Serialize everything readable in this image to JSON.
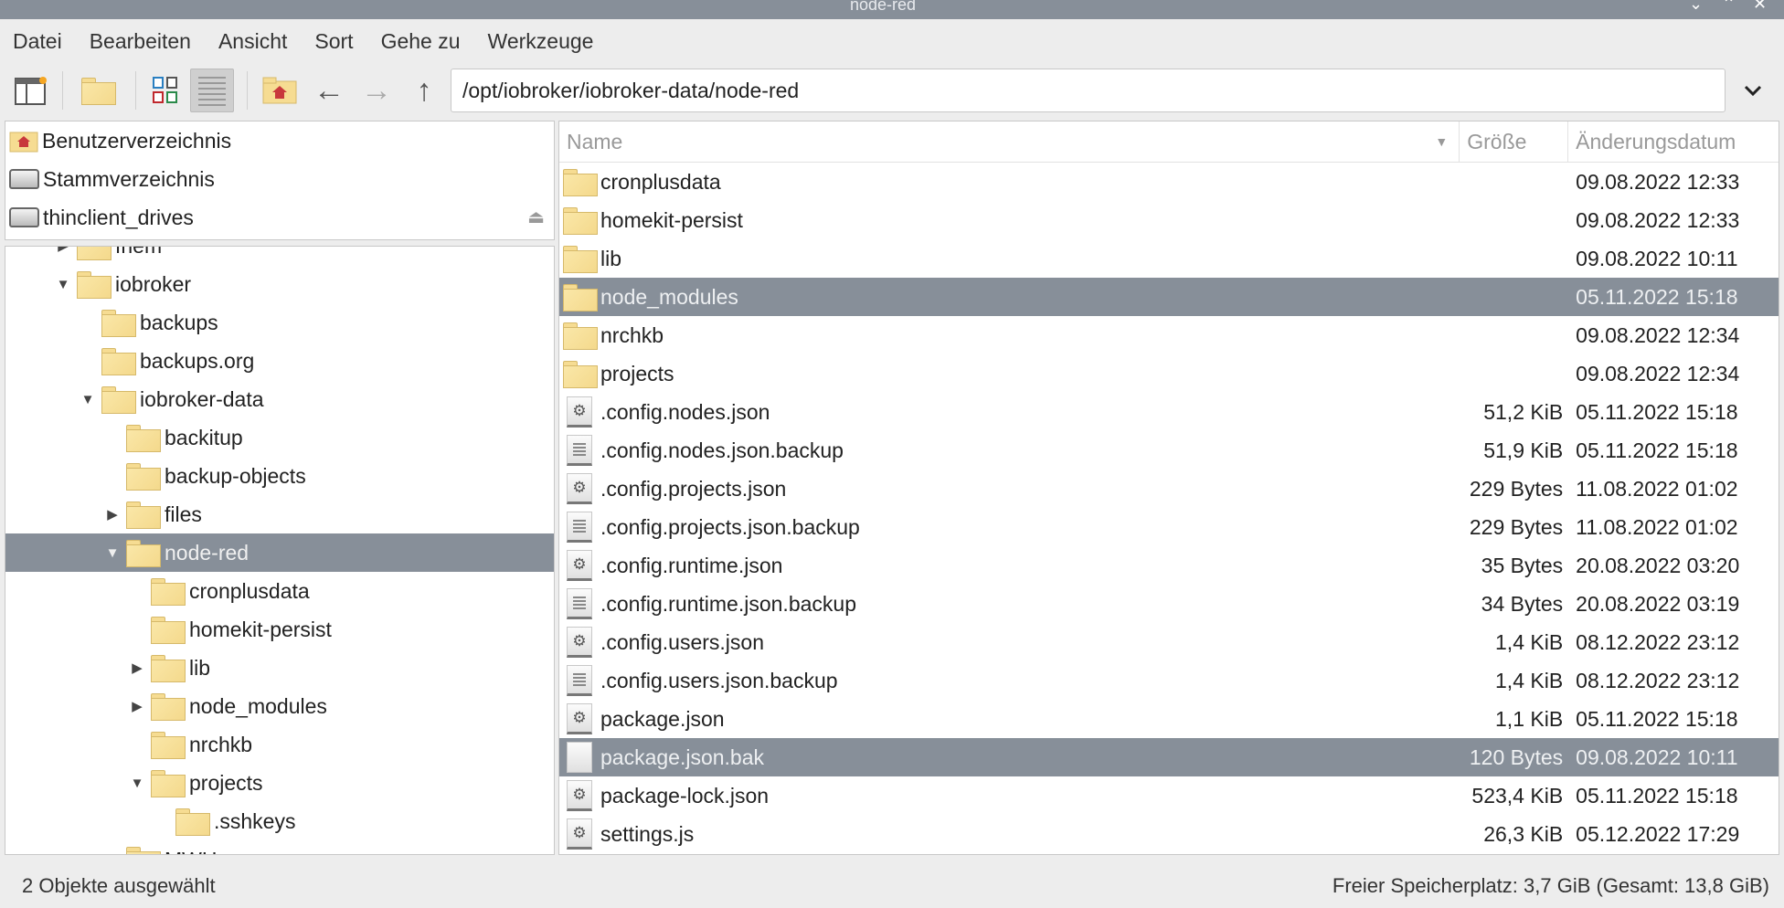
{
  "window": {
    "title": "node-red",
    "controls": [
      "⌄",
      "⌃",
      "✕"
    ]
  },
  "menu": [
    "Datei",
    "Bearbeiten",
    "Ansicht",
    "Sort",
    "Gehe zu",
    "Werkzeuge"
  ],
  "toolbar": {
    "path": "/opt/iobroker/iobroker-data/node-red"
  },
  "places": [
    {
      "label": "Benutzerverzeichnis",
      "icon": "home-folder-icon"
    },
    {
      "label": "Stammverzeichnis",
      "icon": "drive-icon"
    },
    {
      "label": "thinclient_drives",
      "icon": "drive-icon",
      "eject": true
    }
  ],
  "tree": [
    {
      "label": "fhem",
      "depth": 2,
      "exp": "collapsed"
    },
    {
      "label": "iobroker",
      "depth": 2,
      "exp": "expanded"
    },
    {
      "label": "backups",
      "depth": 3,
      "exp": "none"
    },
    {
      "label": "backups.org",
      "depth": 3,
      "exp": "none"
    },
    {
      "label": "iobroker-data",
      "depth": 3,
      "exp": "expanded"
    },
    {
      "label": "backitup",
      "depth": 4,
      "exp": "none"
    },
    {
      "label": "backup-objects",
      "depth": 4,
      "exp": "none"
    },
    {
      "label": "files",
      "depth": 4,
      "exp": "collapsed"
    },
    {
      "label": "node-red",
      "depth": 4,
      "exp": "expanded",
      "selected": true
    },
    {
      "label": "cronplusdata",
      "depth": 5,
      "exp": "none"
    },
    {
      "label": "homekit-persist",
      "depth": 5,
      "exp": "none"
    },
    {
      "label": "lib",
      "depth": 5,
      "exp": "collapsed"
    },
    {
      "label": "node_modules",
      "depth": 5,
      "exp": "collapsed"
    },
    {
      "label": "nrchkb",
      "depth": 5,
      "exp": "none"
    },
    {
      "label": "projects",
      "depth": 5,
      "exp": "expanded"
    },
    {
      "label": ".sshkeys",
      "depth": 6,
      "exp": "none"
    },
    {
      "label": "MWHome",
      "depth": 4,
      "exp": "collapsed"
    }
  ],
  "filelist": {
    "columns": [
      "Name",
      "Größe",
      "Änderungsdatum"
    ],
    "rows": [
      {
        "name": "cronplusdata",
        "size": "",
        "date": "09.08.2022 12:33",
        "type": "folder"
      },
      {
        "name": "homekit-persist",
        "size": "",
        "date": "09.08.2022 12:33",
        "type": "folder"
      },
      {
        "name": "lib",
        "size": "",
        "date": "09.08.2022 10:11",
        "type": "folder"
      },
      {
        "name": "node_modules",
        "size": "",
        "date": "05.11.2022 15:18",
        "type": "folder",
        "selected": true
      },
      {
        "name": "nrchkb",
        "size": "",
        "date": "09.08.2022 12:34",
        "type": "folder"
      },
      {
        "name": "projects",
        "size": "",
        "date": "09.08.2022 12:34",
        "type": "folder"
      },
      {
        "name": ".config.nodes.json",
        "size": "51,2 KiB",
        "date": "05.11.2022 15:18",
        "type": "gear"
      },
      {
        "name": ".config.nodes.json.backup",
        "size": "51,9 KiB",
        "date": "05.11.2022 15:18",
        "type": "lines"
      },
      {
        "name": ".config.projects.json",
        "size": "229 Bytes",
        "date": "11.08.2022 01:02",
        "type": "gear"
      },
      {
        "name": ".config.projects.json.backup",
        "size": "229 Bytes",
        "date": "11.08.2022 01:02",
        "type": "lines"
      },
      {
        "name": ".config.runtime.json",
        "size": "35 Bytes",
        "date": "20.08.2022 03:20",
        "type": "gear"
      },
      {
        "name": ".config.runtime.json.backup",
        "size": "34 Bytes",
        "date": "20.08.2022 03:19",
        "type": "lines"
      },
      {
        "name": ".config.users.json",
        "size": "1,4 KiB",
        "date": "08.12.2022 23:12",
        "type": "gear"
      },
      {
        "name": ".config.users.json.backup",
        "size": "1,4 KiB",
        "date": "08.12.2022 23:12",
        "type": "lines"
      },
      {
        "name": "package.json",
        "size": "1,1 KiB",
        "date": "05.11.2022 15:18",
        "type": "gear"
      },
      {
        "name": "package.json.bak",
        "size": "120 Bytes",
        "date": "09.08.2022 10:11",
        "type": "plain",
        "selected": true
      },
      {
        "name": "package-lock.json",
        "size": "523,4 KiB",
        "date": "05.11.2022 15:18",
        "type": "gear"
      },
      {
        "name": "settings.js",
        "size": "26,3 KiB",
        "date": "05.12.2022 17:29",
        "type": "gear"
      }
    ]
  },
  "status": {
    "left": "2 Objekte ausgewählt",
    "right": "Freier Speicherplatz: 3,7 GiB (Gesamt: 13,8 GiB)"
  }
}
